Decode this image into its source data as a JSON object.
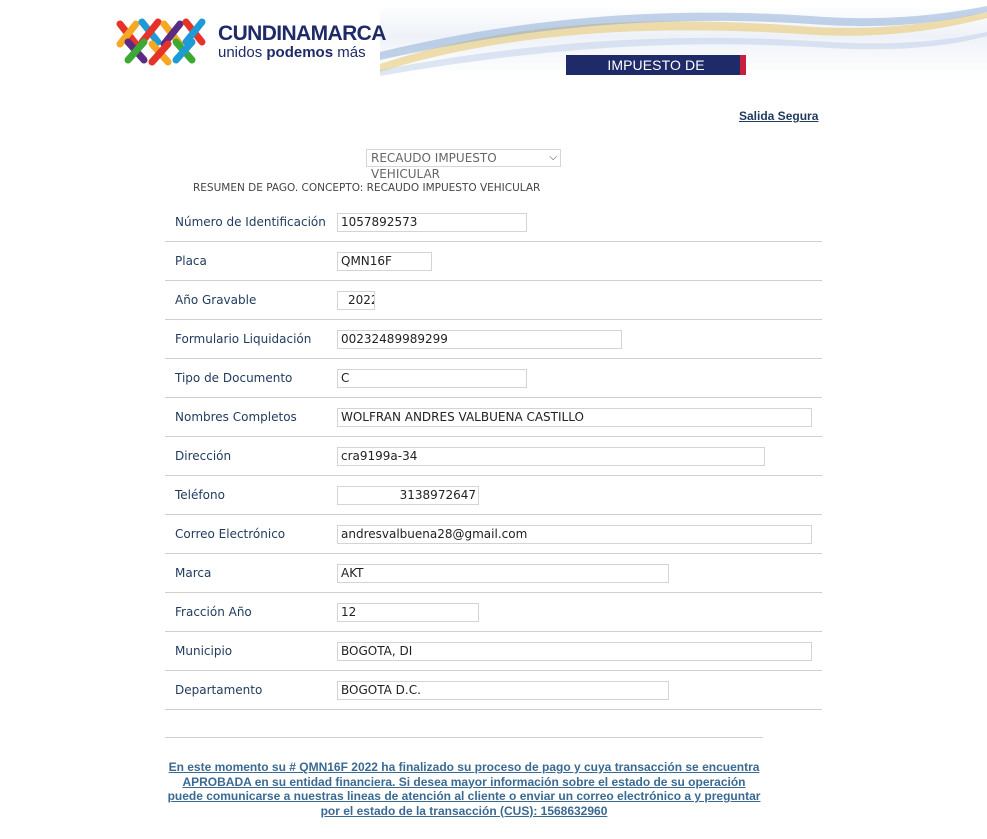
{
  "header": {
    "logo_name": "CUNDINAMARCA",
    "logo_tagline_plain": "unidos ",
    "logo_tagline_bold": "podemos",
    "logo_tagline_end": " más",
    "banner_title": "IMPUESTO DE VEHÍCULOS"
  },
  "nav": {
    "logout_label": "Salida Segura"
  },
  "concept_select": {
    "selected": "RECAUDO IMPUESTO VEHICULAR"
  },
  "summary": {
    "title": "RESUMEN DE PAGO. CONCEPTO: RECAUDO IMPUESTO VEHICULAR"
  },
  "form": {
    "rows": [
      {
        "label": "Número de Identificación",
        "value": "1057892573"
      },
      {
        "label": "Placa",
        "value": "QMN16F"
      },
      {
        "label": "Año Gravable",
        "value": "2022"
      },
      {
        "label": "Formulario Liquidación",
        "value": "00232489989299"
      },
      {
        "label": "Tipo de Documento",
        "value": "C"
      },
      {
        "label": "Nombres Completos",
        "value": "WOLFRAN ANDRES VALBUENA CASTILLO"
      },
      {
        "label": "Dirección",
        "value": "cra9199a-34"
      },
      {
        "label": "Teléfono",
        "value": "3138972647"
      },
      {
        "label": "Correo Electrónico",
        "value": "andresvalbuena28@gmail.com"
      },
      {
        "label": "Marca",
        "value": "AKT"
      },
      {
        "label": "Fracción Año",
        "value": "12"
      },
      {
        "label": "Municipio",
        "value": "BOGOTA, DI"
      },
      {
        "label": "Departamento",
        "value": "BOGOTA D.C."
      }
    ]
  },
  "status_message": "En este momento su # QMN16F 2022 ha finalizado su proceso de pago y cuya transacción se encuentra APROBADA en su entidad financiera. Si desea mayor información sobre el estado de su operación puede comunicarse a nuestras lineas de atención al cliente o enviar un correo electrónico a y preguntar por el estado de la transacción (CUS): 1568632960",
  "colors": {
    "brand_navy": "#1f2a68",
    "brand_red": "#c7203e",
    "label_blue": "#1f3a5c",
    "message_blue": "#3a6a92"
  }
}
